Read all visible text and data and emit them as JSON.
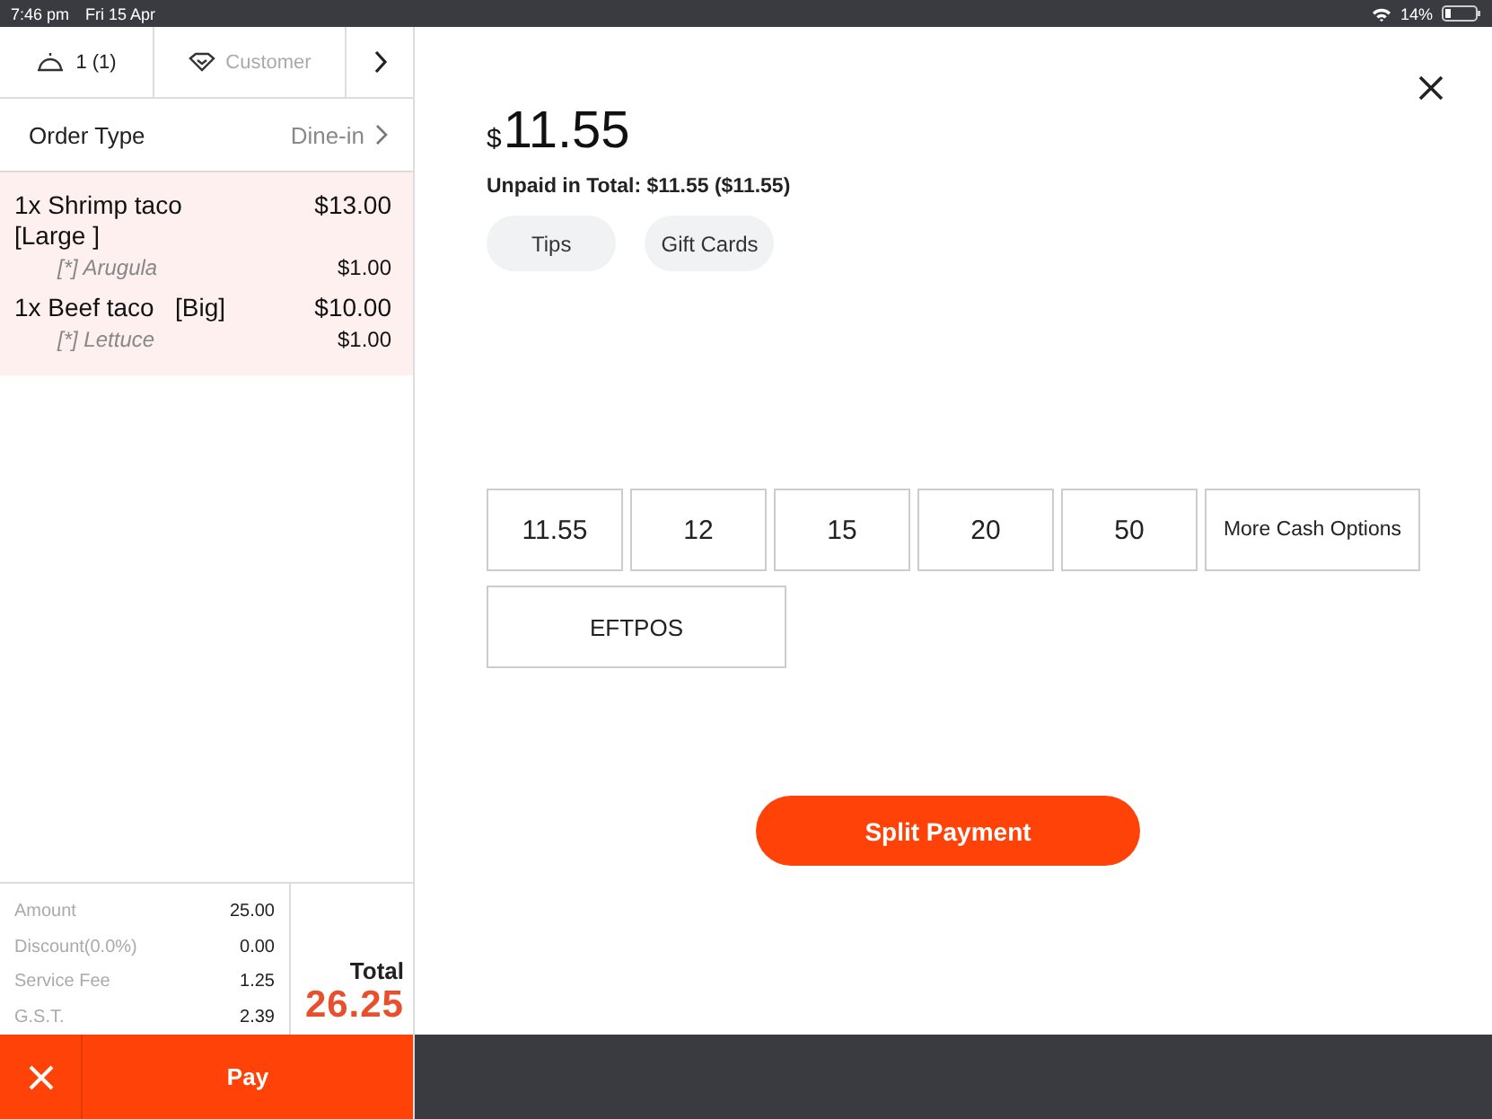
{
  "status_bar": {
    "time": "7:46 pm",
    "date": "Fri 15 Apr",
    "battery": "14%"
  },
  "order_header": {
    "guests": "1 (1)",
    "customer_placeholder": "Customer"
  },
  "order_type": {
    "label": "Order Type",
    "value": "Dine-in"
  },
  "items": [
    {
      "name": "1x Shrimp taco",
      "variant": "[Large ]",
      "price": "$13.00",
      "modifiers": [
        {
          "name": "[*] Arugula",
          "price": "$1.00"
        }
      ]
    },
    {
      "name": "1x Beef taco",
      "variant": "[Big]",
      "price": "$10.00",
      "modifiers": [
        {
          "name": "[*] Lettuce",
          "price": "$1.00"
        }
      ]
    }
  ],
  "summary": [
    {
      "label": "Amount",
      "value": "25.00"
    },
    {
      "label": "Discount(0.0%)",
      "value": "0.00"
    },
    {
      "label": "Service Fee",
      "value": "1.25"
    },
    {
      "label": "G.S.T.",
      "value": "2.39"
    }
  ],
  "total": {
    "label": "Total",
    "value": "26.25"
  },
  "pay_button": "Pay",
  "payment": {
    "currency": "$",
    "amount": "11.55",
    "unpaid": "Unpaid in Total: $11.55 ($11.55)",
    "chips": [
      "Tips",
      "Gift Cards"
    ],
    "cash_options": [
      "11.55",
      "12",
      "15",
      "20",
      "50",
      "More Cash Options"
    ],
    "methods": [
      "EFTPOS"
    ],
    "split_button": "Split Payment"
  }
}
